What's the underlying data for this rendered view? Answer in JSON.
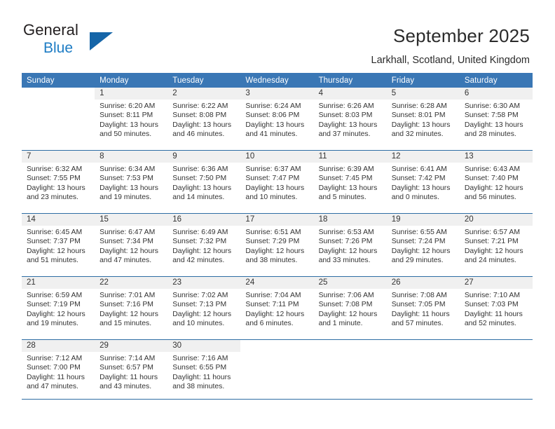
{
  "brand": {
    "line1": "General",
    "line2": "Blue",
    "triangle_color": "#1565a8",
    "blue_text_color": "#1d7cc4"
  },
  "header": {
    "title": "September 2025",
    "subtitle": "Larkhall, Scotland, United Kingdom"
  },
  "theme": {
    "header_bar": "#3a77b5",
    "separator": "#2e6da4",
    "daynum_strip": "#f0f0f0",
    "text": "#333333"
  },
  "weekdays": [
    "Sunday",
    "Monday",
    "Tuesday",
    "Wednesday",
    "Thursday",
    "Friday",
    "Saturday"
  ],
  "weeks": [
    [
      {
        "day": "",
        "detail": ""
      },
      {
        "day": "1",
        "detail": "Sunrise: 6:20 AM\nSunset: 8:11 PM\nDaylight: 13 hours\nand 50 minutes."
      },
      {
        "day": "2",
        "detail": "Sunrise: 6:22 AM\nSunset: 8:08 PM\nDaylight: 13 hours\nand 46 minutes."
      },
      {
        "day": "3",
        "detail": "Sunrise: 6:24 AM\nSunset: 8:06 PM\nDaylight: 13 hours\nand 41 minutes."
      },
      {
        "day": "4",
        "detail": "Sunrise: 6:26 AM\nSunset: 8:03 PM\nDaylight: 13 hours\nand 37 minutes."
      },
      {
        "day": "5",
        "detail": "Sunrise: 6:28 AM\nSunset: 8:01 PM\nDaylight: 13 hours\nand 32 minutes."
      },
      {
        "day": "6",
        "detail": "Sunrise: 6:30 AM\nSunset: 7:58 PM\nDaylight: 13 hours\nand 28 minutes."
      }
    ],
    [
      {
        "day": "7",
        "detail": "Sunrise: 6:32 AM\nSunset: 7:55 PM\nDaylight: 13 hours\nand 23 minutes."
      },
      {
        "day": "8",
        "detail": "Sunrise: 6:34 AM\nSunset: 7:53 PM\nDaylight: 13 hours\nand 19 minutes."
      },
      {
        "day": "9",
        "detail": "Sunrise: 6:36 AM\nSunset: 7:50 PM\nDaylight: 13 hours\nand 14 minutes."
      },
      {
        "day": "10",
        "detail": "Sunrise: 6:37 AM\nSunset: 7:47 PM\nDaylight: 13 hours\nand 10 minutes."
      },
      {
        "day": "11",
        "detail": "Sunrise: 6:39 AM\nSunset: 7:45 PM\nDaylight: 13 hours\nand 5 minutes."
      },
      {
        "day": "12",
        "detail": "Sunrise: 6:41 AM\nSunset: 7:42 PM\nDaylight: 13 hours\nand 0 minutes."
      },
      {
        "day": "13",
        "detail": "Sunrise: 6:43 AM\nSunset: 7:40 PM\nDaylight: 12 hours\nand 56 minutes."
      }
    ],
    [
      {
        "day": "14",
        "detail": "Sunrise: 6:45 AM\nSunset: 7:37 PM\nDaylight: 12 hours\nand 51 minutes."
      },
      {
        "day": "15",
        "detail": "Sunrise: 6:47 AM\nSunset: 7:34 PM\nDaylight: 12 hours\nand 47 minutes."
      },
      {
        "day": "16",
        "detail": "Sunrise: 6:49 AM\nSunset: 7:32 PM\nDaylight: 12 hours\nand 42 minutes."
      },
      {
        "day": "17",
        "detail": "Sunrise: 6:51 AM\nSunset: 7:29 PM\nDaylight: 12 hours\nand 38 minutes."
      },
      {
        "day": "18",
        "detail": "Sunrise: 6:53 AM\nSunset: 7:26 PM\nDaylight: 12 hours\nand 33 minutes."
      },
      {
        "day": "19",
        "detail": "Sunrise: 6:55 AM\nSunset: 7:24 PM\nDaylight: 12 hours\nand 29 minutes."
      },
      {
        "day": "20",
        "detail": "Sunrise: 6:57 AM\nSunset: 7:21 PM\nDaylight: 12 hours\nand 24 minutes."
      }
    ],
    [
      {
        "day": "21",
        "detail": "Sunrise: 6:59 AM\nSunset: 7:19 PM\nDaylight: 12 hours\nand 19 minutes."
      },
      {
        "day": "22",
        "detail": "Sunrise: 7:01 AM\nSunset: 7:16 PM\nDaylight: 12 hours\nand 15 minutes."
      },
      {
        "day": "23",
        "detail": "Sunrise: 7:02 AM\nSunset: 7:13 PM\nDaylight: 12 hours\nand 10 minutes."
      },
      {
        "day": "24",
        "detail": "Sunrise: 7:04 AM\nSunset: 7:11 PM\nDaylight: 12 hours\nand 6 minutes."
      },
      {
        "day": "25",
        "detail": "Sunrise: 7:06 AM\nSunset: 7:08 PM\nDaylight: 12 hours\nand 1 minute."
      },
      {
        "day": "26",
        "detail": "Sunrise: 7:08 AM\nSunset: 7:05 PM\nDaylight: 11 hours\nand 57 minutes."
      },
      {
        "day": "27",
        "detail": "Sunrise: 7:10 AM\nSunset: 7:03 PM\nDaylight: 11 hours\nand 52 minutes."
      }
    ],
    [
      {
        "day": "28",
        "detail": "Sunrise: 7:12 AM\nSunset: 7:00 PM\nDaylight: 11 hours\nand 47 minutes."
      },
      {
        "day": "29",
        "detail": "Sunrise: 7:14 AM\nSunset: 6:57 PM\nDaylight: 11 hours\nand 43 minutes."
      },
      {
        "day": "30",
        "detail": "Sunrise: 7:16 AM\nSunset: 6:55 PM\nDaylight: 11 hours\nand 38 minutes."
      },
      {
        "day": "",
        "detail": ""
      },
      {
        "day": "",
        "detail": ""
      },
      {
        "day": "",
        "detail": ""
      },
      {
        "day": "",
        "detail": ""
      }
    ]
  ]
}
